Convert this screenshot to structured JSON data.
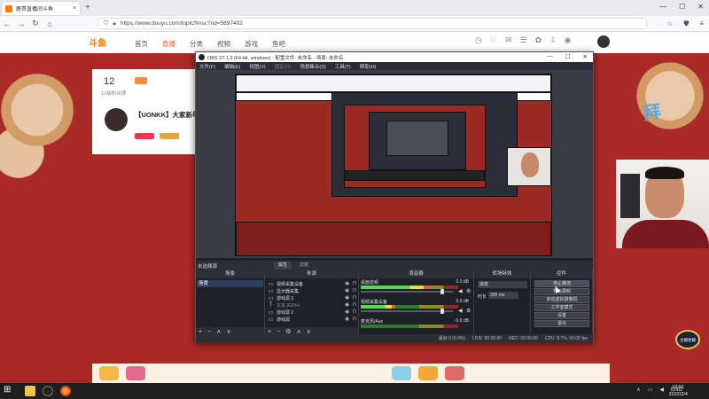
{
  "browser": {
    "tab_title": "鹿哥直播间斗鱼",
    "tab_close": "×",
    "new_tab": "+",
    "url": "https://www.douyu.com/topic/fmsc?rid=5897402",
    "win_min": "—",
    "win_max": "☐",
    "win_close": "✕"
  },
  "site": {
    "logo": "斗鱼",
    "nav": [
      "首页",
      "直播",
      "分类",
      "视频",
      "游戏",
      "鱼吧"
    ],
    "active_nav": "直播",
    "card_number": "12",
    "card_number_label": "12级粉丝牌",
    "streamer_title": "【UONKK】大家新年"
  },
  "obs": {
    "title": "OBS 27.1.3 (64-bit, windows) - 配置文件: 未命名 - 场景: 未命名",
    "menu": [
      "文件(F)",
      "编辑(E)",
      "视图(V)",
      "固定(D)",
      "场景集合(S)",
      "工具(T)",
      "帮助(H)"
    ],
    "scene_tab_label": "未选择源",
    "tab_scene": "属性",
    "tab_source": "滤镜",
    "panels": {
      "scenes": "场景",
      "sources": "来源",
      "mixer": "混音器",
      "transitions": "转场特效",
      "controls": "控件"
    },
    "scene_items": [
      "场景"
    ],
    "sources": [
      {
        "icon": "window-icon",
        "glyph": "▭",
        "name": "视频采集设备"
      },
      {
        "icon": "monitor-icon",
        "glyph": "▭",
        "name": "显示器采集"
      },
      {
        "icon": "window-icon",
        "glyph": "▭",
        "name": "游戏源 3"
      },
      {
        "icon": "text-icon",
        "glyph": "T",
        "name": "文本 (GDI+)"
      },
      {
        "icon": "window-icon",
        "glyph": "▭",
        "name": "游戏源 2"
      },
      {
        "icon": "window-icon",
        "glyph": "▭",
        "name": "游戏源"
      }
    ],
    "mixer": [
      {
        "name": "桌面音频",
        "db": "0.0 dB",
        "level": 0.72,
        "volume": 0.88
      },
      {
        "name": "视频采集设备",
        "db": "0.0 dB",
        "level": 0.35,
        "volume": 0.88
      },
      {
        "name": "麦克风/Aux",
        "db": "-0.0 dB",
        "level": 0.0,
        "volume": 0.88
      }
    ],
    "transition": "渐变",
    "duration_label": "时长",
    "duration_value": "300 ms",
    "controls": [
      "停止推流",
      "开始录制",
      "启动虚拟摄像机",
      "工作室模式",
      "设置",
      "退出"
    ],
    "highlighted_control": "停止推流",
    "status": [
      "丢帧 0 (0.0%)",
      "LIVE: 00:00:00",
      "REC: 00:00:00",
      "CPU: 8.7%, 60.00 fps"
    ]
  },
  "taskbar": {
    "lang": "ENG",
    "time": "13:51",
    "date": "2022/2/4"
  },
  "live_badge": "主播星耀"
}
